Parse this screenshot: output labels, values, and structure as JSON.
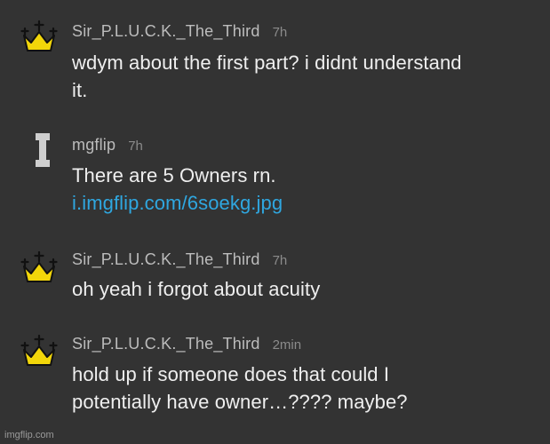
{
  "comments": [
    {
      "avatar_icon": "crown-icon",
      "username": "Sir_P.L.U.C.K._The_Third",
      "time": "7h",
      "lines": [
        "wdym about the first part? i didnt understand",
        "it."
      ]
    },
    {
      "avatar_icon": "imgflip-i-logo-icon",
      "username": "mgflip",
      "time": "7h",
      "lines": [
        "There are 5 Owners rn."
      ],
      "link": "i.imgflip.com/6soekg.jpg"
    },
    {
      "avatar_icon": "crown-icon",
      "username": "Sir_P.L.U.C.K._The_Third",
      "time": "7h",
      "lines": [
        "oh yeah i forgot about acuity"
      ]
    },
    {
      "avatar_icon": "crown-icon",
      "username": "Sir_P.L.U.C.K._The_Third",
      "time": "2min",
      "lines": [
        "hold up if someone does that could I",
        "potentially have owner…???? maybe?"
      ]
    }
  ],
  "watermark": "imgflip.com",
  "colors": {
    "background": "#333333",
    "username": "#bcbcbc",
    "timestamp": "#8b8b8b",
    "text": "#efefef",
    "link": "#2fa7e0",
    "crown": "#f2d60a"
  }
}
